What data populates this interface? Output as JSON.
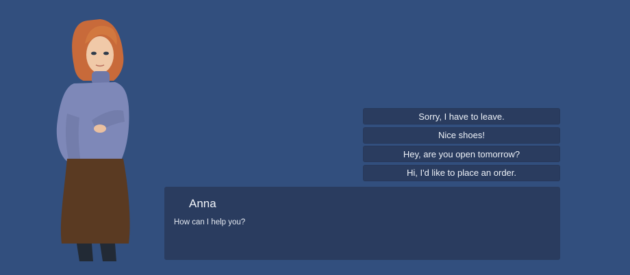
{
  "character": {
    "portrait": "woman-character-portrait"
  },
  "choices": [
    {
      "label": "Sorry, I have to leave."
    },
    {
      "label": "Nice shoes!"
    },
    {
      "label": "Hey, are you open tomorrow?"
    },
    {
      "label": "Hi, I'd like to place an order."
    }
  ],
  "dialogue": {
    "speaker": "Anna",
    "text": "How can I help you?"
  },
  "colors": {
    "background": "#324f7e",
    "panel": "#2a3c5f",
    "text": "#eef2f8"
  }
}
